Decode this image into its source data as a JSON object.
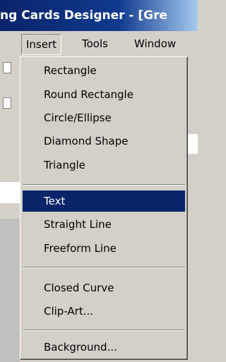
{
  "window": {
    "title": "ng Cards Designer - [Gre"
  },
  "menubar": {
    "items": [
      {
        "label": ""
      },
      {
        "label": "Insert"
      },
      {
        "label": "Tools"
      },
      {
        "label": "Window"
      }
    ]
  },
  "insert_menu": {
    "items": [
      {
        "label": "Rectangle"
      },
      {
        "label": "Round Rectangle"
      },
      {
        "label": "Circle/Ellipse"
      },
      {
        "label": "Diamond Shape"
      },
      {
        "label": "Triangle"
      },
      {
        "label": "Text"
      },
      {
        "label": "Straight Line"
      },
      {
        "label": "Freeform Line"
      },
      {
        "label": "Closed Curve"
      },
      {
        "label": "Clip-Art..."
      },
      {
        "label": "Background..."
      }
    ],
    "selected": "Text"
  },
  "colors": {
    "titlebar": "#0a246a",
    "selection": "#0a246a",
    "menu_bg": "#d4d0c8"
  }
}
